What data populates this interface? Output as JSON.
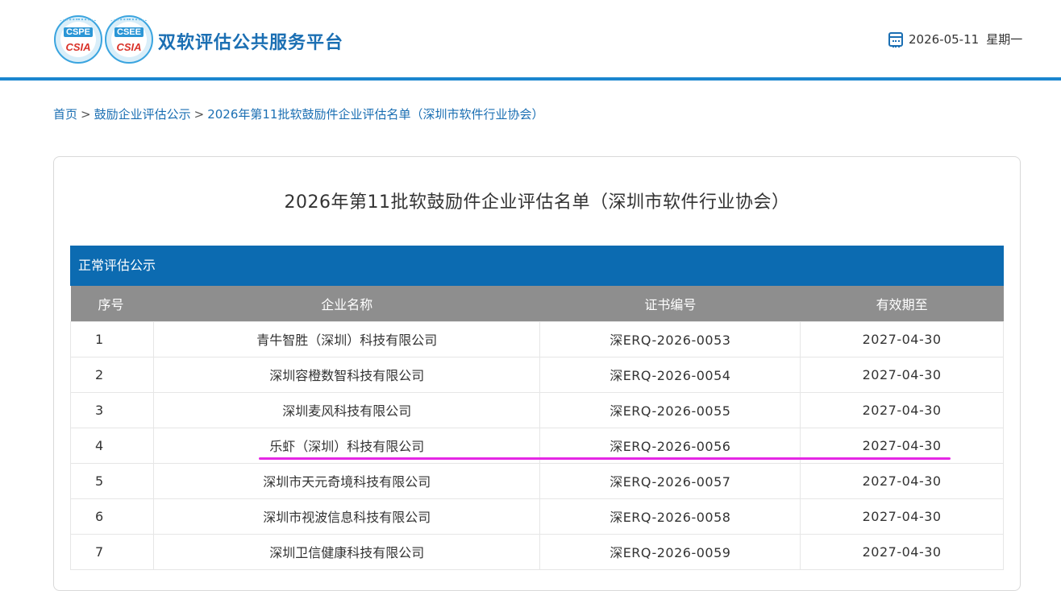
{
  "header": {
    "logos": [
      {
        "abbr": "CSPE",
        "mark": "CSIA"
      },
      {
        "abbr": "CSEE",
        "mark": "CSIA"
      }
    ],
    "site_title": "双软评估公共服务平台",
    "date": "2026-05-11",
    "weekday": "星期一",
    "icon": "calendar-icon"
  },
  "breadcrumb": {
    "home": "首页",
    "category": "鼓励企业评估公示",
    "current": "2026年第11批软鼓励件企业评估名单（深圳市软件行业协会）",
    "separator": ">"
  },
  "page": {
    "title": "2026年第11批软鼓励件企业评估名单（深圳市软件行业协会）",
    "section_label": "正常评估公示"
  },
  "table": {
    "headers": [
      "序号",
      "企业名称",
      "证书编号",
      "有效期至"
    ],
    "rows": [
      {
        "idx": "1",
        "name": "青牛智胜（深圳）科技有限公司",
        "cert": "深ERQ-2026-0053",
        "expiry": "2027-04-30"
      },
      {
        "idx": "2",
        "name": "深圳容橙数智科技有限公司",
        "cert": "深ERQ-2026-0054",
        "expiry": "2027-04-30"
      },
      {
        "idx": "3",
        "name": "深圳麦风科技有限公司",
        "cert": "深ERQ-2026-0055",
        "expiry": "2027-04-30"
      },
      {
        "idx": "4",
        "name": "乐虾（深圳）科技有限公司",
        "cert": "深ERQ-2026-0056",
        "expiry": "2027-04-30"
      },
      {
        "idx": "5",
        "name": "深圳市天元奇境科技有限公司",
        "cert": "深ERQ-2026-0057",
        "expiry": "2027-04-30"
      },
      {
        "idx": "6",
        "name": "深圳市视波信息科技有限公司",
        "cert": "深ERQ-2026-0058",
        "expiry": "2027-04-30"
      },
      {
        "idx": "7",
        "name": "深圳卫信健康科技有限公司",
        "cert": "深ERQ-2026-0059",
        "expiry": "2027-04-30"
      }
    ]
  },
  "colors": {
    "brand_blue": "#1b6fb3",
    "section_bar": "#0c6bb1",
    "table_header": "#8e8e8e",
    "highlight_line": "#e527e5"
  }
}
